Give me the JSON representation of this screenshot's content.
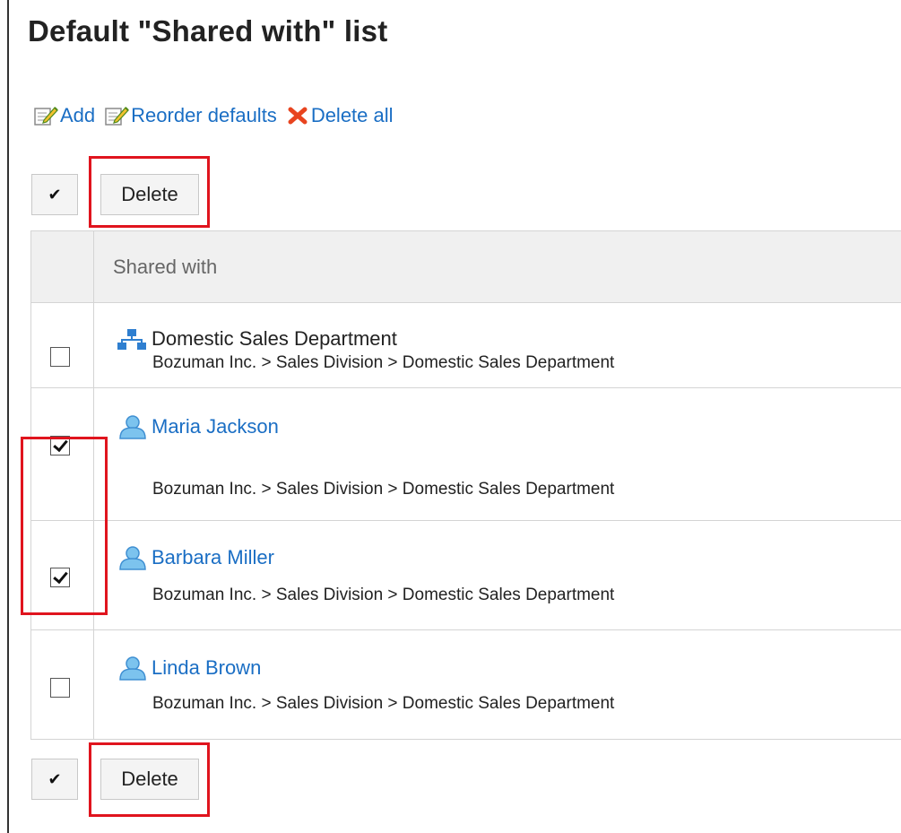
{
  "page": {
    "title": "Default \"Shared with\" list"
  },
  "toolbar": {
    "add_label": "Add",
    "reorder_label": "Reorder defaults",
    "delete_all_label": "Delete all"
  },
  "selection": {
    "select_all_glyph": "✔",
    "delete_label": "Delete"
  },
  "table": {
    "column_header": "Shared with",
    "rows": [
      {
        "type": "organization",
        "icon": "org-chart-icon",
        "name": "Domestic Sales Department",
        "path": "Bozuman Inc. > Sales Division > Domestic Sales Department",
        "checked": false
      },
      {
        "type": "user",
        "icon": "user-icon",
        "name": "Maria Jackson",
        "path": "Bozuman Inc. > Sales Division > Domestic Sales Department",
        "checked": true
      },
      {
        "type": "user",
        "icon": "user-icon",
        "name": "Barbara Miller",
        "path": "Bozuman Inc. > Sales Division > Domestic Sales Department",
        "checked": true
      },
      {
        "type": "user",
        "icon": "user-icon",
        "name": "Linda Brown",
        "path": "Bozuman Inc. > Sales Division > Domestic Sales Department",
        "checked": false
      }
    ]
  },
  "colors": {
    "link": "#1a6ec4",
    "highlight": "#e0141e",
    "delete_x": "#e8441f",
    "header_bg": "#f0f0f0"
  }
}
